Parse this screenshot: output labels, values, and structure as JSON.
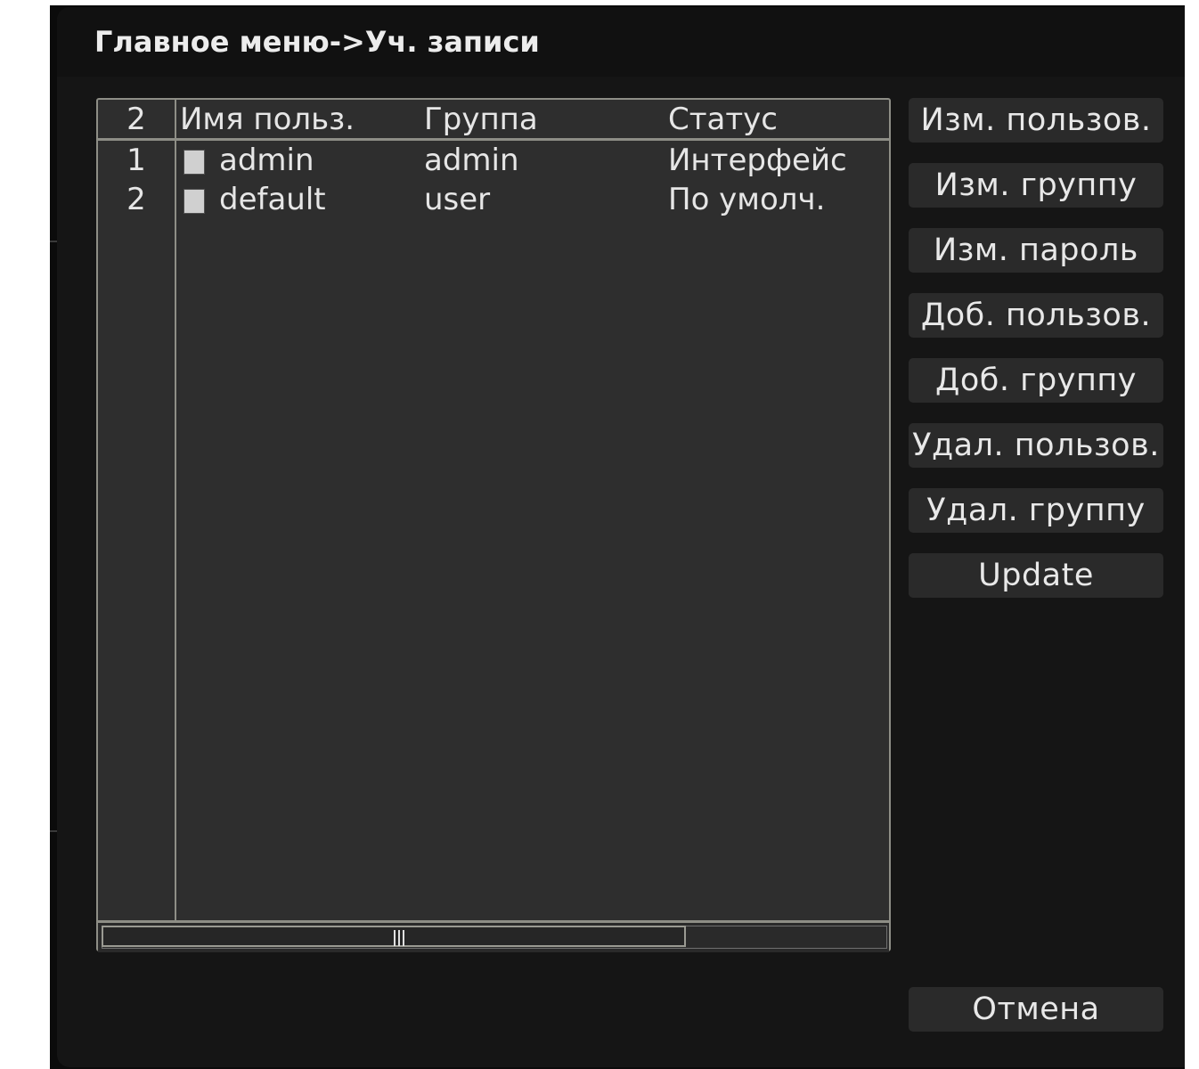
{
  "window": {
    "title": "Главное меню->Уч. записи"
  },
  "table": {
    "count": "2",
    "headers": {
      "name": "Имя польз.",
      "group": "Группа",
      "status": "Статус"
    },
    "rows": [
      {
        "index": "1",
        "name": "admin",
        "group": "admin",
        "status": "Интерфейс",
        "checked": false
      },
      {
        "index": "2",
        "name": "default",
        "group": "user",
        "status": "По умолч.",
        "checked": false
      }
    ]
  },
  "actions": {
    "modify_user": "Изм. пользов.",
    "modify_group": "Изм. группу",
    "modify_password": "Изм. пароль",
    "add_user": "Доб. пользов.",
    "add_group": "Доб. группу",
    "delete_user": "Удал. пользов.",
    "delete_group": "Удал. группу",
    "update": "Update",
    "cancel": "Отмена"
  },
  "colors": {
    "background": "#151515",
    "table_background": "#2e2e2e",
    "border": "#8e8e86",
    "button": "#2a2a2a",
    "text": "#e6e6e6"
  }
}
